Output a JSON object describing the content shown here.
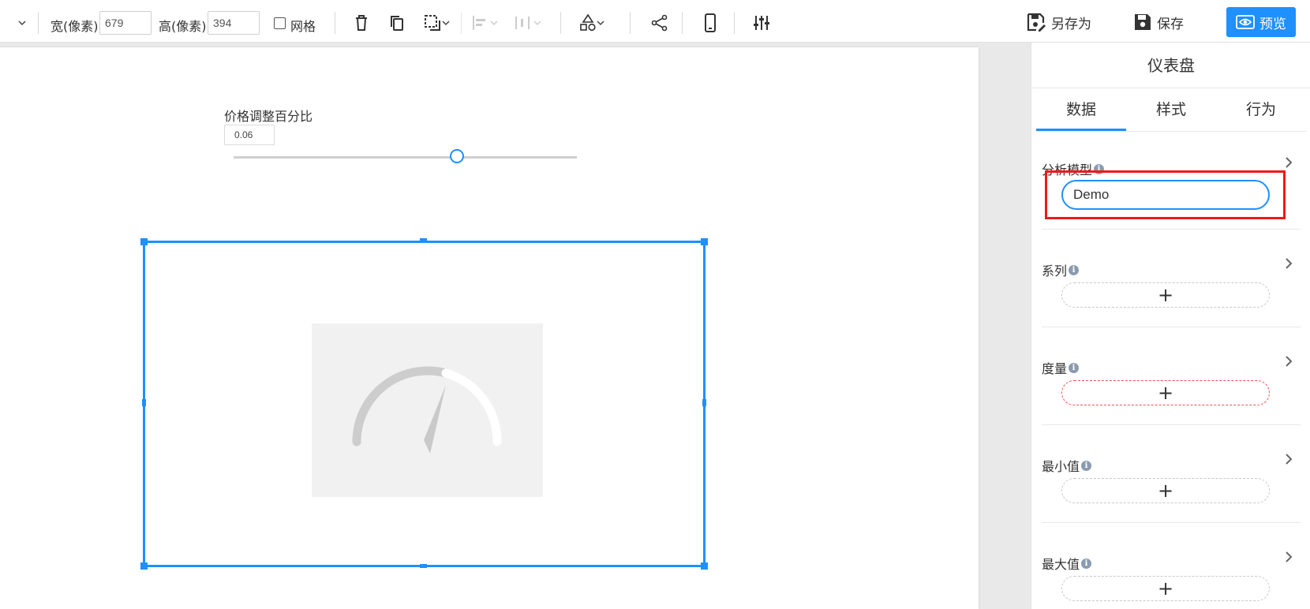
{
  "toolbar": {
    "width_label": "宽(像素)",
    "width_value": "679",
    "height_label": "高(像素)",
    "height_value": "394",
    "grid_label": "网格",
    "save_as_label": "另存为",
    "save_label": "保存",
    "preview_label": "预览",
    "accent_color": "#1e90ff"
  },
  "canvas": {
    "slider": {
      "title": "价格调整百分比",
      "value": "0.06",
      "handle_position_fraction": 0.65
    },
    "widget": {
      "placeholder_icon": "gauge-icon"
    }
  },
  "panel": {
    "title": "仪表盘",
    "tabs": [
      {
        "label": "数据",
        "active": true
      },
      {
        "label": "样式",
        "active": false
      },
      {
        "label": "行为",
        "active": false
      }
    ],
    "sections": [
      {
        "label": "分析模型",
        "value": "Demo"
      },
      {
        "label": "系列",
        "add_symbol": "+"
      },
      {
        "label": "度量",
        "add_symbol": "+",
        "required": true
      },
      {
        "label": "最小值",
        "add_symbol": "+"
      },
      {
        "label": "最大值",
        "add_symbol": "+"
      }
    ],
    "info_glyph": "i",
    "highlight_color": "#f21818"
  }
}
